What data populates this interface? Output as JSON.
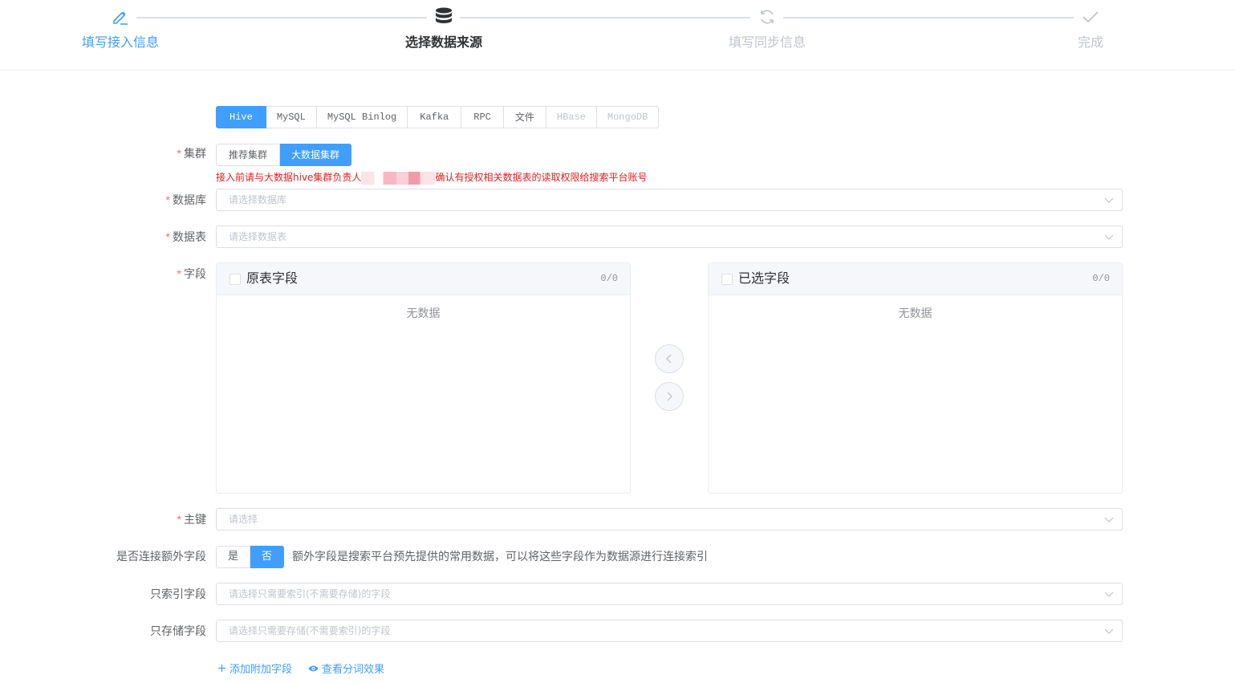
{
  "steps": [
    {
      "title": "填写接入信息",
      "icon": "pencil-icon",
      "status": "done"
    },
    {
      "title": "选择数据来源",
      "icon": "database-icon",
      "status": "active"
    },
    {
      "title": "填写同步信息",
      "icon": "refresh-icon",
      "status": "wait"
    },
    {
      "title": "完成",
      "icon": "check-icon",
      "status": "wait"
    }
  ],
  "source_tabs": [
    "Hive",
    "MySQL",
    "MySQL Binlog",
    "Kafka",
    "RPC",
    "文件",
    "HBase",
    "MongoDB"
  ],
  "source_selected": "Hive",
  "source_disabled": [
    "HBase",
    "MongoDB"
  ],
  "colors": {
    "primary": "#409eff",
    "required": "#f56c6c",
    "warning": "#e02020"
  },
  "form": {
    "cluster": {
      "label": "集群",
      "options": [
        "推荐集群",
        "大数据集群"
      ],
      "selected": "大数据集群"
    },
    "cluster_warning_before": "接入前请与大数据hive集群负责人",
    "cluster_warning_after": "确认有授权相关数据表的读取权限给搜索平台账号",
    "database": {
      "label": "数据库",
      "placeholder": "请选择数据库"
    },
    "table": {
      "label": "数据表",
      "placeholder": "请选择数据表"
    },
    "fields": {
      "label": "字段",
      "left_title": "原表字段",
      "left_count": "0/0",
      "right_title": "已选字段",
      "right_count": "0/0",
      "empty_text": "无数据"
    },
    "primary_key": {
      "label": "主键",
      "placeholder": "请选择"
    },
    "extra": {
      "label": "是否连接额外字段",
      "options": [
        "是",
        "否"
      ],
      "selected": "否",
      "note": "额外字段是搜索平台预先提供的常用数据，可以将这些字段作为数据源进行连接索引"
    },
    "index_only": {
      "label": "只索引字段",
      "placeholder": "请选择只需要索引(不需要存储)的字段"
    },
    "store_only": {
      "label": "只存储字段",
      "placeholder": "请选择只需要存储(不需要索引)的字段"
    }
  },
  "links": {
    "add_field": "添加附加字段",
    "view_tokenize": "查看分词效果"
  }
}
